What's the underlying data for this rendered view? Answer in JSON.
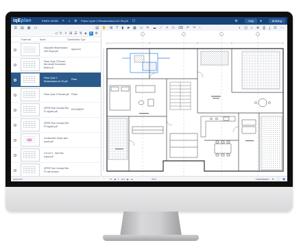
{
  "app": {
    "logo_text_a": "iqE",
    "logo_text_b": "plan",
    "tab_home": "ENRG HDSB",
    "tab_count": "4",
    "doc_title": "Plans Cycle 2 Resubmission A1 09.pdf",
    "btn_help": "Help",
    "btn_user": "Building",
    "icon_gear": "gear-icon",
    "icon_bell": "bell-icon"
  },
  "sidebar": {
    "headers": {
      "thumbnail": "Thumbnail",
      "name": "Name",
      "classification": "Classification Type"
    },
    "rows": [
      {
        "name": "Associate Resubmission 2022 Boyd.pdf",
        "class": "Approved",
        "thumb": "text",
        "selected": false
      },
      {
        "name": "Plans Cycle 2 Pioneer Bev Arwell Enrichment Beam.pdf",
        "class": "",
        "thumb": "plan",
        "selected": false
      },
      {
        "name": "Plans Cycle 2 Resubmission A1 09.pdf",
        "class": "Plans",
        "thumb": "plan",
        "selected": true
      },
      {
        "name": "Plans Cycle 2 Planner.pdf",
        "class": "Plumb",
        "thumb": "plan",
        "selected": false
      },
      {
        "name": "UPRR Floor Concept Bev P1 signed.pdf",
        "class": "DOCUMENT",
        "thumb": "plan",
        "selected": false
      },
      {
        "name": "UPRR Floor Concept Bev P2 signed.pdf",
        "class": "",
        "thumb": "plan",
        "selected": false
      },
      {
        "name": "Construction Scope plan report.pdf",
        "class": "",
        "thumb": "pink",
        "selected": false
      },
      {
        "name": "CYCLE 2 - Site Plan report.pdf",
        "class": "",
        "thumb": "plan",
        "selected": false
      },
      {
        "name": "UPRR Floor Concept Bev P1 with Access",
        "class": "",
        "thumb": "plan",
        "selected": false
      }
    ],
    "status": "Approved"
  },
  "statusbar": {
    "page": "1",
    "pages": "of 1",
    "zoom": "44.5",
    "classification": "Classification"
  }
}
